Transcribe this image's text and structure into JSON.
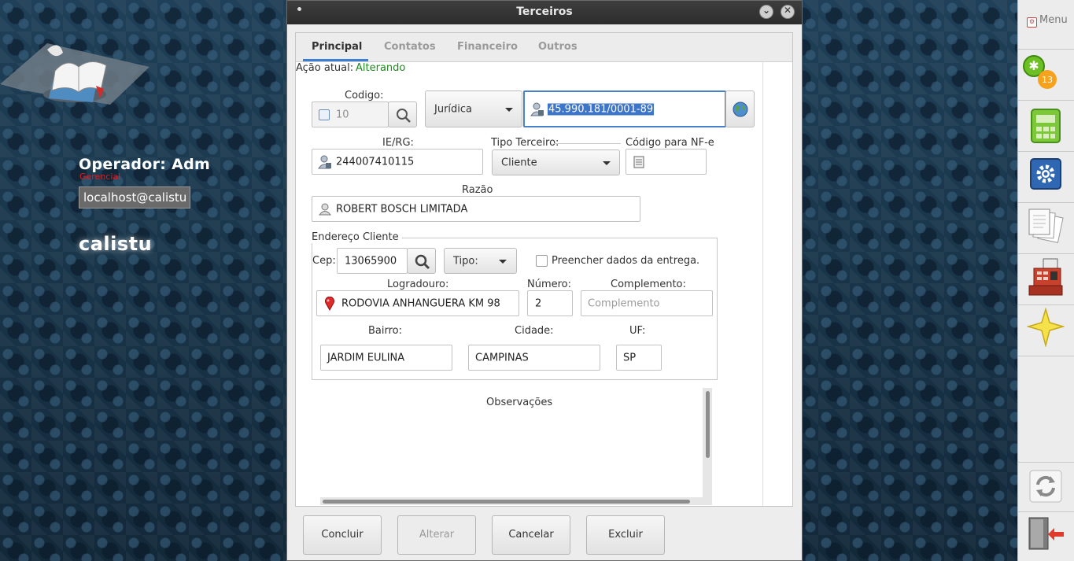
{
  "desktop": {
    "operator": "Operador: Adm",
    "role": "Gerencial",
    "host": "localhost@calistu",
    "app_name": "calistu"
  },
  "dock": {
    "menu_label": "Menu",
    "badge_count": "13",
    "items": [
      "alerts-icon",
      "calculator-icon",
      "settings-icon",
      "documents-icon",
      "cash-register-icon",
      "favorites-star-icon",
      "refresh-icon",
      "exit-icon"
    ]
  },
  "dialog": {
    "title": "Terceiros",
    "tabs": [
      "Principal",
      "Contatos",
      "Financeiro",
      "Outros"
    ],
    "active_tab": "Principal",
    "acao_label": "Ação atual:",
    "acao_value": "Alterando",
    "codigo_label": "Codigo:",
    "codigo_value": "10",
    "pessoa_tipo": "Jurídica",
    "cnpj": "45.990.181/0001-89",
    "ie_label": "IE/RG:",
    "ie_value": "244007410115",
    "tipo_terceiro_label": "Tipo Terceiro:",
    "tipo_terceiro_value": "Cliente",
    "codigo_nfe_label": "Código para NF-e",
    "codigo_nfe_value": "",
    "razao_label": "Razão",
    "razao_value": "ROBERT BOSCH LIMITADA",
    "endereco_label": "Endereço Cliente",
    "cep_label": "Cep:",
    "cep_value": "13065900",
    "tipo_label": "Tipo:",
    "preencher_label": "Preencher dados da entrega.",
    "preencher_checked": false,
    "logradouro_label": "Logradouro:",
    "logradouro_value": "RODOVIA ANHANGUERA KM 98",
    "numero_label": "Número:",
    "numero_value": "2",
    "complemento_label": "Complemento:",
    "complemento_placeholder": "Complemento",
    "bairro_label": "Bairro:",
    "bairro_value": "JARDIM EULINA",
    "cidade_label": "Cidade:",
    "cidade_value": "CAMPINAS",
    "uf_label": "UF:",
    "uf_value": "SP",
    "observacoes_label": "Observações",
    "buttons": {
      "concluir": "Concluir",
      "alterar": "Alterar",
      "cancelar": "Cancelar",
      "excluir": "Excluir"
    }
  },
  "colors": {
    "accent": "#3b7fd4",
    "status_green": "#1f8a1f",
    "role_red": "#e21a1a"
  }
}
